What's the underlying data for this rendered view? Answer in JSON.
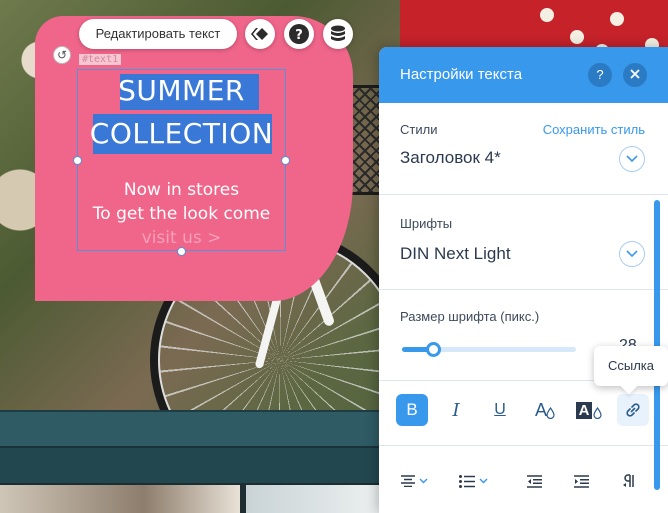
{
  "toolbar": {
    "edit_text_label": "Редактировать текст"
  },
  "element": {
    "id_label": "#text1"
  },
  "promo": {
    "title_line1": "SUMMER",
    "title_line2": "COLLECTION",
    "body_line1": "Now in stores",
    "body_line2": "To get the look come",
    "link_line": "visit us >"
  },
  "panel": {
    "title": "Настройки текста",
    "help_icon": "?",
    "styles": {
      "label": "Стили",
      "save_link": "Сохранить стиль",
      "value": "Заголовок 4*"
    },
    "fonts": {
      "label": "Шрифты",
      "value": "DIN Next Light"
    },
    "font_size": {
      "label": "Размер шрифта (пикс.)",
      "value": "28",
      "slider_fraction": 0.18
    },
    "formatting": {
      "bold": "B",
      "italic": "I",
      "underline": "U",
      "text_color": "A",
      "highlight": "A"
    },
    "tooltip": "Ссылка"
  },
  "colors": {
    "accent": "#3899ec",
    "promo_pink": "#f0658a"
  }
}
